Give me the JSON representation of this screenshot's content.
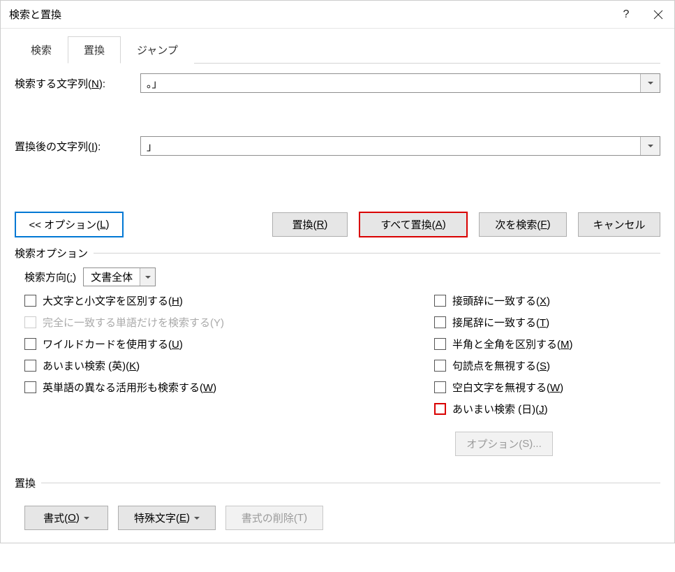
{
  "window": {
    "title": "検索と置換"
  },
  "tabs": {
    "search": "検索",
    "replace": "置換",
    "jump": "ジャンプ"
  },
  "fields": {
    "search_label_pre": "検索する文字列(",
    "search_label_key": "N",
    "search_label_post": "):",
    "search_value": "。」",
    "replace_label_pre": "置換後の文字列(",
    "replace_label_key": "I",
    "replace_label_post": "):",
    "replace_value": "」"
  },
  "buttons": {
    "options_pre": "<< オプション(",
    "options_key": "L",
    "options_post": ")",
    "replace_pre": "置換(",
    "replace_key": "R",
    "replace_post": ")",
    "replace_all_pre": "すべて置換(",
    "replace_all_key": "A",
    "replace_all_post": ")",
    "find_next_pre": "次を検索(",
    "find_next_key": "F",
    "find_next_post": ")",
    "cancel": "キャンセル"
  },
  "options": {
    "section": "検索オプション",
    "direction_pre": "検索方向(",
    "direction_key": ":",
    "direction_post": ")",
    "direction_value": "文書全体",
    "left": {
      "case_pre": "大文字と小文字を区別する(",
      "case_key": "H",
      "case_post": ")",
      "whole_pre": "完全に一致する単語だけを検索する(",
      "whole_key": "Y",
      "whole_post": ")",
      "wildcard_pre": "ワイルドカードを使用する(",
      "wildcard_key": "U",
      "wildcard_post": ")",
      "fuzzy_en_pre": "あいまい検索 (英)(",
      "fuzzy_en_key": "K",
      "fuzzy_en_post": ")",
      "forms_pre": "英単語の異なる活用形も検索する(",
      "forms_key": "W",
      "forms_post": ")"
    },
    "right": {
      "prefix_pre": "接頭辞に一致する(",
      "prefix_key": "X",
      "prefix_post": ")",
      "suffix_pre": "接尾辞に一致する(",
      "suffix_key": "T",
      "suffix_post": ")",
      "width_pre": "半角と全角を区別する(",
      "width_key": "M",
      "width_post": ")",
      "punct_pre": "句読点を無視する(",
      "punct_key": "S",
      "punct_post": ")",
      "ws_pre": "空白文字を無視する(",
      "ws_key": "W",
      "ws_post": ")",
      "fuzzy_jp_pre": "あいまい検索 (日)(",
      "fuzzy_jp_key": "J",
      "fuzzy_jp_post": ")",
      "options_btn_pre": "オプション(",
      "options_btn_key": "S",
      "options_btn_post": ")..."
    }
  },
  "footer": {
    "section": "置換",
    "format_pre": "書式(",
    "format_key": "O",
    "format_post": ")",
    "special_pre": "特殊文字(",
    "special_key": "E",
    "special_post": ")",
    "noformat_pre": "書式の削除(",
    "noformat_key": "T",
    "noformat_post": ")"
  }
}
